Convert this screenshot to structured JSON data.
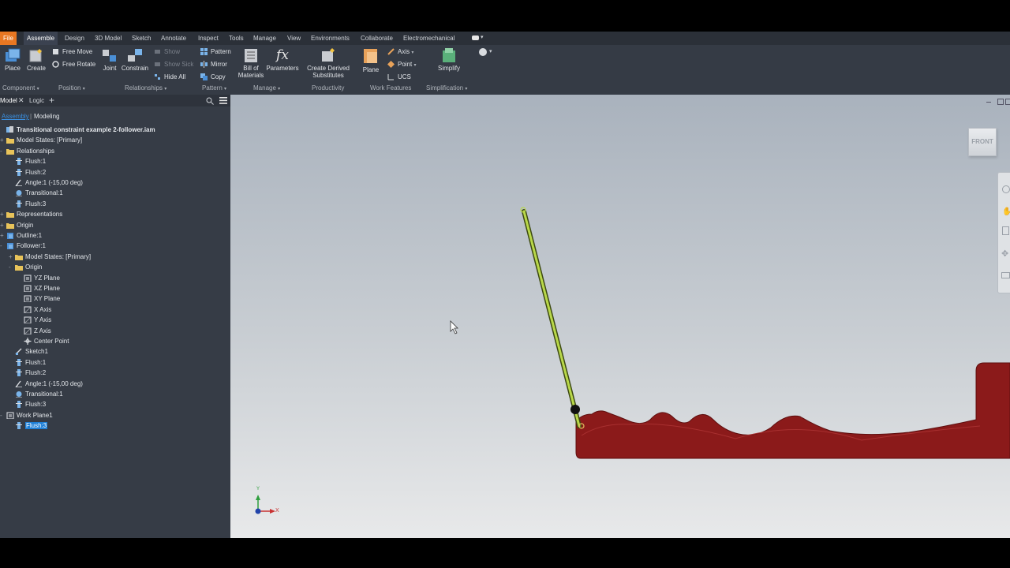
{
  "menu": {
    "file": "File",
    "tabs": [
      "Assemble",
      "Design",
      "3D Model",
      "Sketch",
      "Annotate",
      "Inspect",
      "Tools",
      "Manage",
      "View",
      "Environments",
      "Collaborate",
      "Electromechanical"
    ]
  },
  "ribbon": {
    "place": "Place",
    "create": "Create",
    "free_move": "Free Move",
    "free_rotate": "Free Rotate",
    "joint": "Joint",
    "constrain": "Constrain",
    "show": "Show",
    "show_sick": "Show Sick",
    "hide_all": "Hide All",
    "pattern": "Pattern",
    "mirror": "Mirror",
    "copy": "Copy",
    "bill_1": "Bill of",
    "bill_2": "Materials",
    "parameters": "Parameters",
    "derived_1": "Create Derived",
    "derived_2": "Substitutes",
    "plane": "Plane",
    "axis": "Axis",
    "point": "Point",
    "ucs": "UCS",
    "simplify": "Simplify",
    "groups": {
      "component": "Component",
      "position": "Position",
      "relationships": "Relationships",
      "pattern": "Pattern",
      "manage": "Manage",
      "productivity": "Productivity",
      "work_features": "Work Features",
      "simplification": "Simplification"
    }
  },
  "panel": {
    "tab_model": "Model",
    "tab_logic": "Logic",
    "sub_assembly": "Assembly",
    "sub_modeling": "Modeling",
    "tree": [
      {
        "label": "Transitional constraint example 2-follower.iam",
        "bold": true
      },
      {
        "label": "Model States: [Primary]"
      },
      {
        "label": "Relationships"
      },
      {
        "label": "Flush:1"
      },
      {
        "label": "Flush:2"
      },
      {
        "label": "Angle:1 (-15,00 deg)"
      },
      {
        "label": "Transitional:1"
      },
      {
        "label": "Flush:3"
      },
      {
        "label": "Representations"
      },
      {
        "label": "Origin"
      },
      {
        "label": "Outline:1"
      },
      {
        "label": "Follower:1"
      },
      {
        "label": "Model States: [Primary]"
      },
      {
        "label": "Origin"
      },
      {
        "label": "YZ Plane"
      },
      {
        "label": "XZ Plane"
      },
      {
        "label": "XY Plane"
      },
      {
        "label": "X Axis"
      },
      {
        "label": "Y Axis"
      },
      {
        "label": "Z Axis"
      },
      {
        "label": "Center Point"
      },
      {
        "label": "Sketch1"
      },
      {
        "label": "Flush:1"
      },
      {
        "label": "Flush:2"
      },
      {
        "label": "Angle:1 (-15,00 deg)"
      },
      {
        "label": "Transitional:1"
      },
      {
        "label": "Flush:3"
      },
      {
        "label": "Work Plane1"
      },
      {
        "label": "Flush:3"
      }
    ]
  },
  "viewport": {
    "viewcube_label": "FRONT",
    "axis_x": "X",
    "axis_y": "Y"
  },
  "colors": {
    "accent": "#e87722",
    "selection": "#1e7fd6",
    "cam_red": "#8b1a1a",
    "follower_green": "#b9d84a"
  }
}
